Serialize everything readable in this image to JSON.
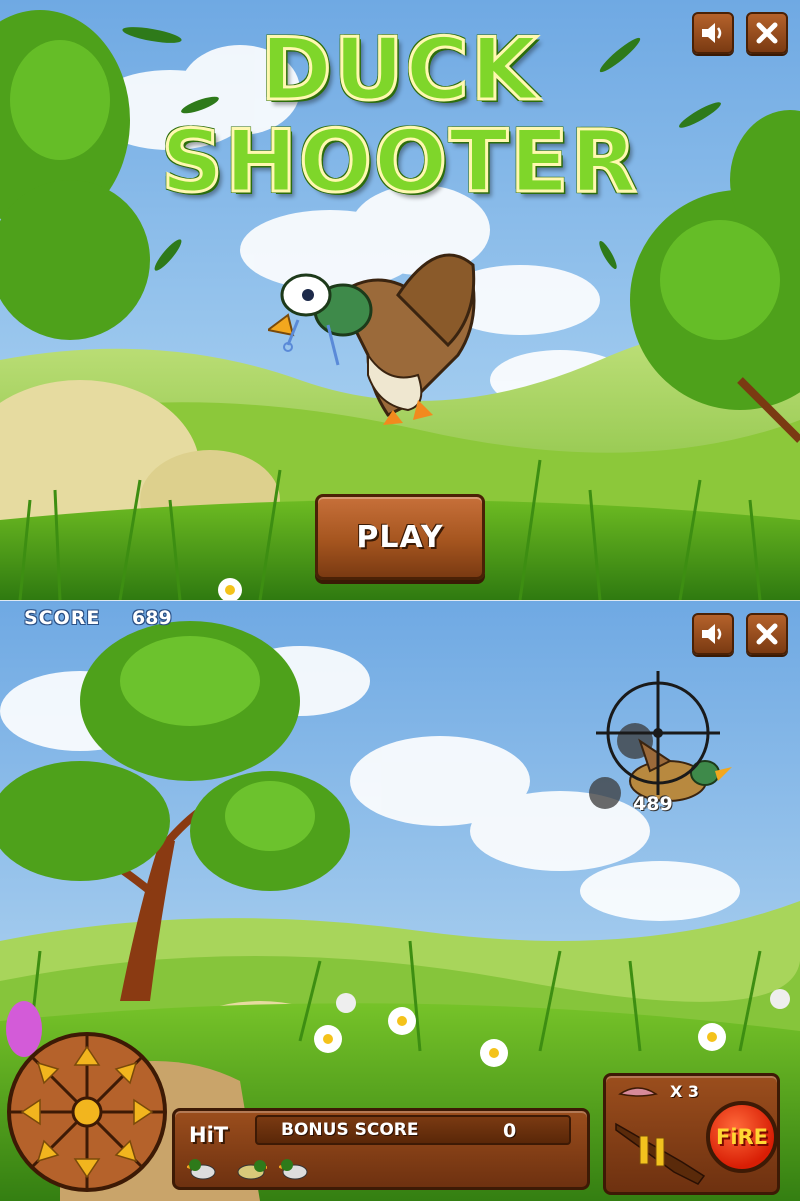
{
  "menu_screen": {
    "title_line1": "DUCK",
    "title_line2": "SHOOTER",
    "play_label": "PLAY",
    "controls": {
      "sound_icon": "speaker-icon",
      "close_icon": "close-icon"
    }
  },
  "game_screen": {
    "score_label": "SCORE",
    "score_value": "689",
    "points_popup": "489",
    "hit_label": "HiT",
    "bonus_label": "BONUS SCORE",
    "bonus_value": "0",
    "ammo_multiplier": "X 3",
    "fire_label": "FiRE",
    "hit_ducks_count": 3,
    "controls": {
      "sound_icon": "speaker-icon",
      "close_icon": "close-icon"
    }
  },
  "colors": {
    "sky": "#7fb6e8",
    "grass": "#5fae1f",
    "wood": "#a5551f",
    "title_green": "#7fd62a",
    "fire_red": "#d81e05"
  }
}
